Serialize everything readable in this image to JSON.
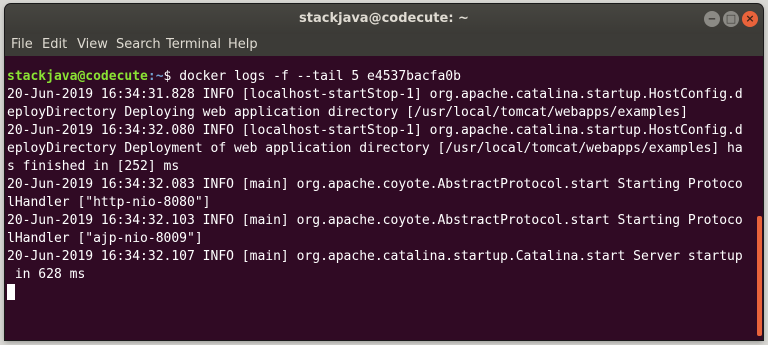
{
  "window": {
    "title": "stackjava@codecute: ~",
    "controls": {
      "minimize": "‒",
      "maximize": "□",
      "close": "×"
    }
  },
  "menu": {
    "items": [
      "File",
      "Edit",
      "View",
      "Search",
      "Terminal",
      "Help"
    ]
  },
  "terminal": {
    "prompt_user": "stackjava@codecute",
    "prompt_path": ":~",
    "prompt_symbol": "$ ",
    "command": "docker logs -f --tail 5 e4537bacfa0b",
    "lines": [
      "20-Jun-2019 16:34:31.828 INFO [localhost-startStop-1] org.apache.catalina.startup.HostConfig.d",
      "eployDirectory Deploying web application directory [/usr/local/tomcat/webapps/examples]",
      "20-Jun-2019 16:34:32.080 INFO [localhost-startStop-1] org.apache.catalina.startup.HostConfig.d",
      "eployDirectory Deployment of web application directory [/usr/local/tomcat/webapps/examples] ha",
      "s finished in [252] ms",
      "20-Jun-2019 16:34:32.083 INFO [main] org.apache.coyote.AbstractProtocol.start Starting Protoco",
      "lHandler [\"http-nio-8080\"]",
      "20-Jun-2019 16:34:32.103 INFO [main] org.apache.coyote.AbstractProtocol.start Starting Protoco",
      "lHandler [\"ajp-nio-8009\"]",
      "20-Jun-2019 16:34:32.107 INFO [main] org.apache.catalina.startup.Catalina.start Server startup",
      " in 628 ms"
    ]
  },
  "colors": {
    "terminal_background": "#300a24",
    "prompt_user": "#8ae234",
    "prompt_path": "#729fcf",
    "scrollbar_thumb": "#e9633b"
  }
}
